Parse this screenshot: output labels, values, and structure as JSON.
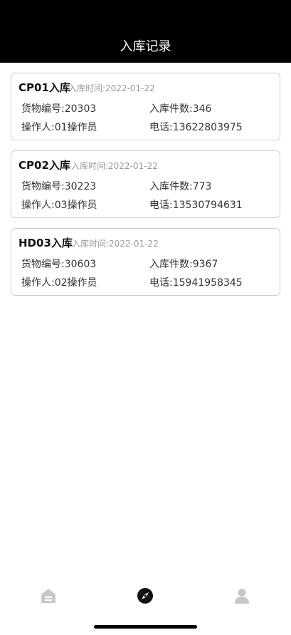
{
  "header": {
    "title": "入库记录"
  },
  "records": [
    {
      "title": "CP01入库",
      "time": "入库时间:2022-01-22",
      "goods_no": "货物编号:20303",
      "quantity": "入库件数:346",
      "operator": "操作人:01操作员",
      "phone": "电话:13622803975"
    },
    {
      "title": "CP02入库",
      "time": "入库时间:2022-01-22",
      "goods_no": "货物编号:30223",
      "quantity": "入库件数:773",
      "operator": "操作人:03操作员",
      "phone": "电话:13530794631"
    },
    {
      "title": "HD03入库",
      "time": "入库时间:2022-01-22",
      "goods_no": "货物编号:30603",
      "quantity": "入库件数:9367",
      "operator": "操作人:02操作员",
      "phone": "电话:15941958345"
    }
  ],
  "tabbar": {
    "items": [
      {
        "icon": "home-icon",
        "active": false
      },
      {
        "icon": "compass-icon",
        "active": true
      },
      {
        "icon": "user-icon",
        "active": false
      }
    ],
    "colors": {
      "active": "#111111",
      "inactive": "#c8c8c8"
    }
  }
}
